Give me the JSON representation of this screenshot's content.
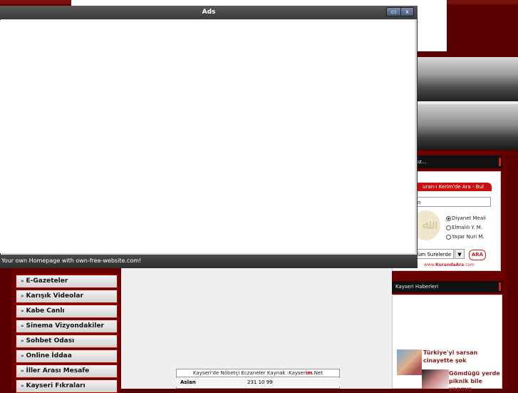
{
  "ads_window": {
    "title": "Ads",
    "minimize_glyph": "▭",
    "close_glyph": "x",
    "status_text": "Your own Homepage with own-free-website.com!"
  },
  "left_menu": {
    "items": [
      {
        "label": "E-Gazeteler"
      },
      {
        "label": "Karışık Videolar"
      },
      {
        "label": "Kabe Canlı"
      },
      {
        "label": "Sinema Vizyondakiler"
      },
      {
        "label": "Sohbet Odası"
      },
      {
        "label": "Online İddaa"
      },
      {
        "label": "İller Arası Mesafe"
      },
      {
        "label": "Kayseri Fıkraları"
      }
    ],
    "arrow_glyph": "»"
  },
  "right_column": {
    "box1_header": "ız...",
    "quran": {
      "banner": "uran-ı Kerim'de Ara - Bul",
      "search_value": "n",
      "logo_glyph": "ﷲ",
      "options": [
        {
          "label": "Diyanet Meali",
          "selected": true
        },
        {
          "label": "Elmalılı Y. M.",
          "selected": false
        },
        {
          "label": "Yaşar Nuri M.",
          "selected": false
        }
      ],
      "select_value": "üm Surelerde",
      "select_arrow": "▼",
      "search_button": "ARA",
      "footer_url_prefix": "www.",
      "footer_url_brand": "KurandaAra",
      "footer_url_suffix": ".com"
    },
    "news_header": "Kayseri Haberleri",
    "news": [
      {
        "headline": "Türkiye'yi sarsan cinayette şok"
      },
      {
        "headline": "Gömdüğü yerde piknik bile yapmış"
      }
    ]
  },
  "nobetci": {
    "title_prefix": "Kayseri'de Nöbetçi Eczaneler Kaynak :Kayser",
    "title_red": "im",
    "title_suffix": ".Net",
    "rows": [
      {
        "name": "Aslan",
        "phone": "231 10 99"
      }
    ]
  },
  "colors": {
    "background": "#5a0000",
    "accent_red": "#c81010",
    "ads_titlebar": "#4a4a4a"
  }
}
